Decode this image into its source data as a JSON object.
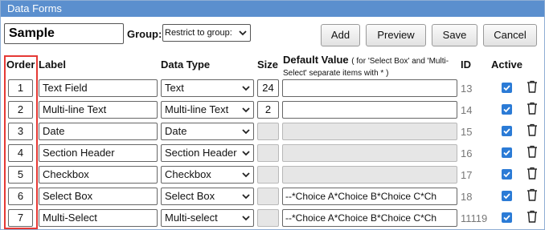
{
  "window": {
    "title": "Data Forms"
  },
  "form": {
    "name_value": "Sample",
    "group_label": "Group:",
    "group_selected": "Restrict to group:"
  },
  "toolbar": {
    "add_label": "Add",
    "preview_label": "Preview",
    "save_label": "Save",
    "cancel_label": "Cancel"
  },
  "table": {
    "headers": {
      "order": "Order",
      "label": "Label",
      "data_type": "Data Type",
      "size": "Size",
      "default_value": "Default Value",
      "default_value_note": "( for 'Select Box' and 'Multi-Select' separate items with * )",
      "id": "ID",
      "active": "Active"
    },
    "rows": [
      {
        "order": "1",
        "label": "Text Field",
        "data_type": "Text",
        "size": "24",
        "default_value": "",
        "id": "13",
        "active": true,
        "size_enabled": true,
        "default_enabled": true
      },
      {
        "order": "2",
        "label": "Multi-line Text",
        "data_type": "Multi-line Text",
        "size": "2",
        "default_value": "",
        "id": "14",
        "active": true,
        "size_enabled": true,
        "default_enabled": true
      },
      {
        "order": "3",
        "label": "Date",
        "data_type": "Date",
        "size": "",
        "default_value": "",
        "id": "15",
        "active": true,
        "size_enabled": false,
        "default_enabled": false
      },
      {
        "order": "4",
        "label": "Section Header",
        "data_type": "Section Header",
        "size": "",
        "default_value": "",
        "id": "16",
        "active": true,
        "size_enabled": false,
        "default_enabled": false
      },
      {
        "order": "5",
        "label": "Checkbox",
        "data_type": "Checkbox",
        "size": "",
        "default_value": "",
        "id": "17",
        "active": true,
        "size_enabled": false,
        "default_enabled": false
      },
      {
        "order": "6",
        "label": "Select Box",
        "data_type": "Select Box",
        "size": "",
        "default_value": "--*Choice A*Choice B*Choice C*Ch",
        "id": "18",
        "active": true,
        "size_enabled": false,
        "default_enabled": true
      },
      {
        "order": "7",
        "label": "Multi-Select",
        "data_type": "Multi-select",
        "size": "",
        "default_value": "--*Choice A*Choice B*Choice C*Ch",
        "id": "11119",
        "active": true,
        "size_enabled": false,
        "default_enabled": true
      }
    ]
  },
  "colors": {
    "titlebar": "#5b8fce",
    "checkbox": "#2b7bd6",
    "highlight_border": "#e53935"
  },
  "icons": {
    "select_caret": "chevron-down-icon",
    "checkbox": "checkmark-icon",
    "delete": "trash-icon"
  }
}
